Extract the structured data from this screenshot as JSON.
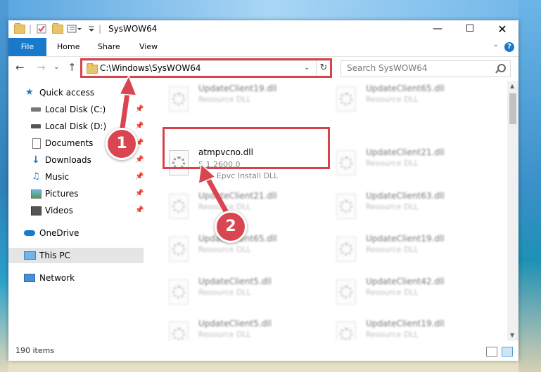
{
  "window": {
    "title": "SysWOW64"
  },
  "ribbon": {
    "file": "File",
    "home": "Home",
    "share": "Share",
    "view": "View",
    "help": "?"
  },
  "address": {
    "path": "C:\\Windows\\SysWOW64"
  },
  "search": {
    "placeholder": "Search SysWOW64"
  },
  "nav": {
    "items": [
      {
        "label": "Quick access",
        "icon": "star-icon"
      },
      {
        "label": "Local Disk (C:)",
        "icon": "drive-icon"
      },
      {
        "label": "Local Disk (D:)",
        "icon": "drive-icon"
      },
      {
        "label": "Documents",
        "icon": "documents-icon"
      },
      {
        "label": "Downloads",
        "icon": "download-icon"
      },
      {
        "label": "Music",
        "icon": "music-icon"
      },
      {
        "label": "Pictures",
        "icon": "pictures-icon"
      },
      {
        "label": "Videos",
        "icon": "videos-icon"
      },
      {
        "label": "OneDrive",
        "icon": "cloud-icon"
      },
      {
        "label": "This PC",
        "icon": "computer-icon"
      },
      {
        "label": "Network",
        "icon": "network-icon"
      }
    ]
  },
  "files": {
    "selected": {
      "name": "atmpvcno.dll",
      "version": "5.1.2600.0",
      "desc": "Atm Epvc Install DLL"
    },
    "col1": [
      {
        "name": "UpdateClient19.dll",
        "desc": "Resource DLL"
      },
      {
        "name": "UpdateClient21.dll",
        "desc": "Resource DLL"
      },
      {
        "name": "UpdateClient65.dll",
        "desc": "Resource DLL"
      },
      {
        "name": "UpdateClient5.dll",
        "desc": "Resource DLL"
      },
      {
        "name": "UpdateClient5.dll",
        "desc": "Resource DLL"
      }
    ],
    "col2": [
      {
        "name": "UpdateClient65.dll",
        "desc": "Resource DLL"
      },
      {
        "name": "UpdateClient21.dll",
        "desc": "Resource DLL"
      },
      {
        "name": "UpdateClient63.dll",
        "desc": "Resource DLL"
      },
      {
        "name": "UpdateClient19.dll",
        "desc": "Resource DLL"
      },
      {
        "name": "UpdateClient42.dll",
        "desc": "Resource DLL"
      },
      {
        "name": "UpdateClient19.dll",
        "desc": "Resource DLL"
      }
    ]
  },
  "status": {
    "count": "190 items"
  },
  "callouts": {
    "one": "1",
    "two": "2"
  },
  "colors": {
    "accent": "#1979ca",
    "highlight": "#d9434e"
  }
}
